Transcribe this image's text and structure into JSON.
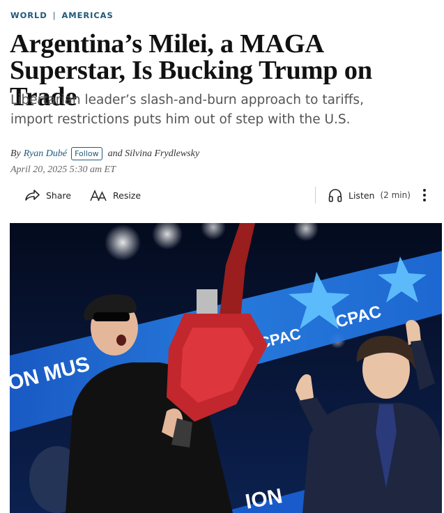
{
  "breadcrumb": {
    "section": "WORLD",
    "subsection": "AMERICAS"
  },
  "headline": "Argentina’s Milei, a MAGA Superstar, Is Bucking Trump on Trade",
  "dek": "Libertarian leader’s slash-and-burn approach to tariffs, import restrictions puts him out of step with the U.S.",
  "byline": {
    "by": "By",
    "author": "Ryan Dubé",
    "follow_label": "Follow",
    "coauthor": "and Silvina Frydlewsky"
  },
  "timestamp": "April 20, 2025 5:30 am ET",
  "toolbar": {
    "share_label": "Share",
    "resize_label": "Resize",
    "listen_label": "Listen",
    "listen_duration": "(2 min)"
  },
  "photo": {
    "stage_text_left": "ON MUS",
    "stage_text_bottom": "ION",
    "logo_text": "CPAC"
  },
  "colors": {
    "accent": "#1f5a7a",
    "headline": "#111111",
    "dek": "#555555"
  },
  "icons": {
    "share": "share-icon",
    "resize": "resize-icon",
    "listen": "headphones-icon",
    "more": "more-vertical-icon"
  }
}
